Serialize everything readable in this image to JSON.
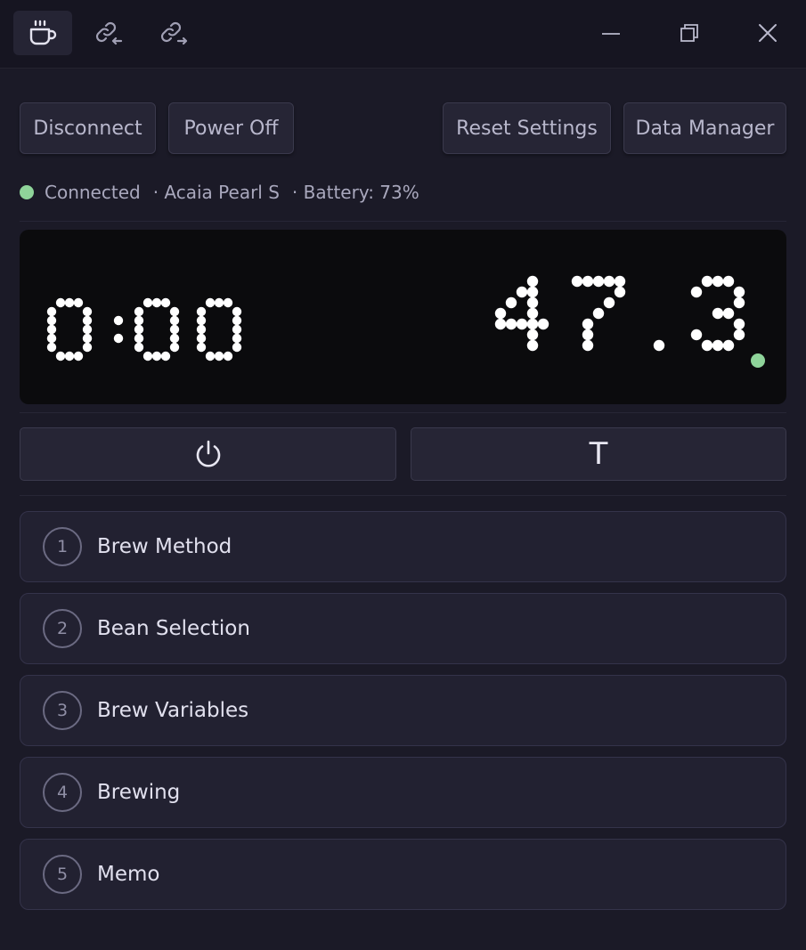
{
  "titlebar": {
    "icons": [
      "coffee-cup-icon",
      "link-in-icon",
      "link-out-icon"
    ],
    "window_controls": [
      "minimize-icon",
      "restore-icon",
      "close-icon"
    ]
  },
  "toolbar": {
    "disconnect_label": "Disconnect",
    "power_off_label": "Power Off",
    "reset_settings_label": "Reset Settings",
    "data_manager_label": "Data Manager"
  },
  "status": {
    "connection": "Connected",
    "device": "· Acaia Pearl S",
    "battery": "· Battery: 73%",
    "indicator_color": "#8fd49a"
  },
  "display": {
    "timer": "0:00",
    "weight": "47.3",
    "stable_indicator_color": "#8fd49a"
  },
  "controls": {
    "power_icon": "power-icon",
    "tare_label": "T"
  },
  "steps": [
    {
      "number": "1",
      "label": "Brew Method"
    },
    {
      "number": "2",
      "label": "Bean Selection"
    },
    {
      "number": "3",
      "label": "Brew Variables"
    },
    {
      "number": "4",
      "label": "Brewing"
    },
    {
      "number": "5",
      "label": "Memo"
    }
  ]
}
